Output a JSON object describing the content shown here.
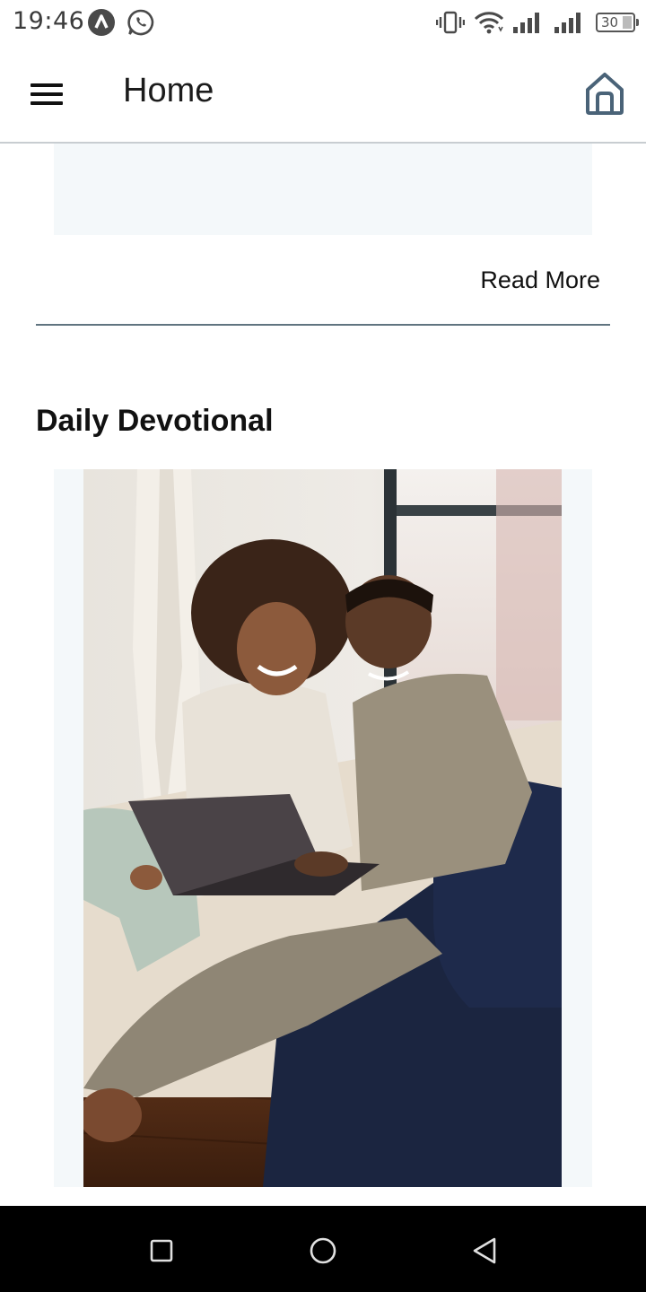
{
  "status_bar": {
    "time": "19:46",
    "battery_level": "30",
    "icons": [
      "app-notification-icon",
      "whatsapp-icon",
      "vibrate-icon",
      "wifi-icon",
      "signal-icon",
      "signal-icon",
      "battery-icon"
    ]
  },
  "app_bar": {
    "title": "Home",
    "menu_icon": "hamburger-menu-icon",
    "home_icon": "home-icon"
  },
  "previous_card": {
    "read_more_label": "Read More"
  },
  "daily_devotional": {
    "section_title": "Daily Devotional"
  },
  "navigation_bar": {
    "buttons": [
      "recent-apps",
      "home",
      "back"
    ]
  },
  "colors": {
    "card_background": "#f4f8fa",
    "divider": "#607480",
    "app_bar_border": "#c8cdd1",
    "home_icon": "#4a6378"
  }
}
